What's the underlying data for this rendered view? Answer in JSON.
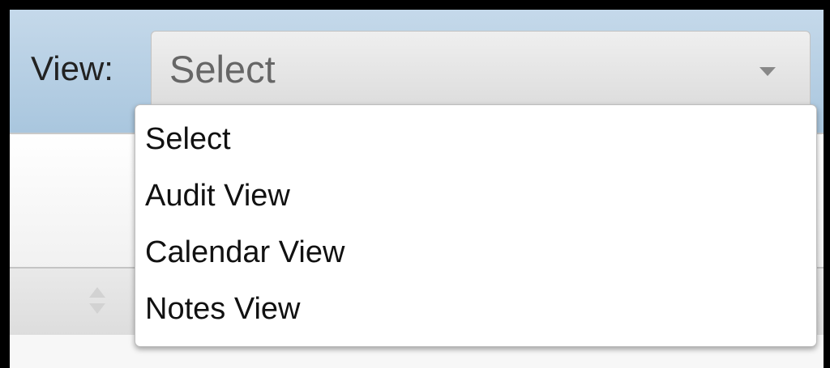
{
  "view_filter": {
    "label": "View:",
    "selected_value": "Select",
    "dropdown_icon": "chevron-down-icon",
    "options": [
      {
        "label": "Select"
      },
      {
        "label": "Audit View"
      },
      {
        "label": "Calendar View"
      },
      {
        "label": "Notes View"
      }
    ],
    "dropdown_open": true
  },
  "table": {
    "sort_icon": "sort-icon"
  },
  "colors": {
    "toolbar_background": "#b7d0e5",
    "select_text": "#666666",
    "option_text": "#111111"
  }
}
